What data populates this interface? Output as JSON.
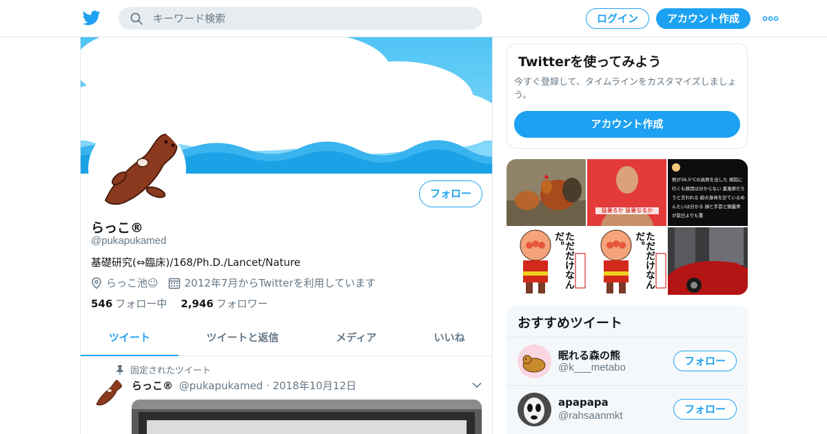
{
  "colors": {
    "accent": "#1da1f2",
    "text": "#14171a",
    "muted": "#657786",
    "border": "#e1e8ed"
  },
  "nav": {
    "logo_icon": "twitter-bird-icon",
    "search_placeholder": "キーワード検索",
    "login_label": "ログイン",
    "signup_label": "アカウント作成",
    "more_icon": "more-dots-icon"
  },
  "profile": {
    "name": "らっこ®",
    "handle": "@pukapukamed",
    "bio": "基礎研究(⇔臨床)/168/Ph.D./Lancet/Nature",
    "location": "らっこ池☺",
    "joined": "2012年7月からTwitterを利用しています",
    "follow_label": "フォロー",
    "following_count": "546",
    "following_label": "フォロー中",
    "followers_count": "2,946",
    "followers_label": "フォロワー"
  },
  "tabs": [
    {
      "label": "ツイート",
      "active": true
    },
    {
      "label": "ツイートと返信",
      "active": false
    },
    {
      "label": "メディア",
      "active": false
    },
    {
      "label": "いいね",
      "active": false
    }
  ],
  "pinned_tweet": {
    "pinned_label": "固定されたツイート",
    "author_name": "らっこ®",
    "author_handle": "@pukapukamed",
    "separator": "·",
    "date": "2018年10月12日"
  },
  "signup_card": {
    "title": "Twitterを使ってみよう",
    "description": "今すぐ登録して、タイムラインをカスタマイズしましょう。",
    "button_label": "アカウント作成"
  },
  "media_grid": {
    "tile2_caption": "猛暑るか 猛暑なるか",
    "tile3_text": "熱が39.5°Cの高熱を出した 病院に行くも原因は分からない 夏風邪だろうと言われる 娘の身体を診ているめんたいは分かる 顔と手首と頸蓋骨が前日よりも重",
    "tile_anpan_text": "ただだけなんだ。"
  },
  "recommended": {
    "title": "おすすめツイート",
    "users": [
      {
        "name": "眠れる森の熊",
        "handle": "@k___metabo",
        "button_label": "フォロー"
      },
      {
        "name": "apapapa",
        "handle": "@rahsaanmkt",
        "button_label": "フォロー"
      }
    ]
  }
}
